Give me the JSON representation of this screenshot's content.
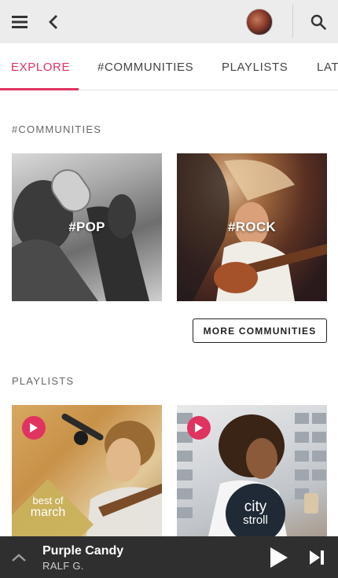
{
  "colors": {
    "accent": "#e0335f",
    "appbar": "#ececec",
    "player": "#2f2f2f"
  },
  "appbar": {
    "menu_icon": "hamburger-menu-icon",
    "back_icon": "chevron-left-icon",
    "avatar_icon": "user-avatar",
    "search_icon": "search-icon"
  },
  "tabs": [
    {
      "label": "EXPLORE",
      "active": true
    },
    {
      "label": "#COMMUNITIES",
      "active": false
    },
    {
      "label": "PLAYLISTS",
      "active": false
    },
    {
      "label": "LAT",
      "active": false
    }
  ],
  "communities": {
    "heading": "#COMMUNITIES",
    "items": [
      {
        "label": "#POP"
      },
      {
        "label": "#ROCK"
      }
    ],
    "more_button": "MORE COMMUNITIES"
  },
  "playlists": {
    "heading": "PLAYLISTS",
    "items": [
      {
        "badge_line1": "best of",
        "badge_line2": "march",
        "play_icon": "play-icon"
      },
      {
        "badge_line1": "city",
        "badge_line2": "stroll",
        "play_icon": "play-icon"
      }
    ]
  },
  "player": {
    "title": "Purple Candy",
    "artist": "RALF G.",
    "expand_icon": "chevron-up-icon",
    "play_icon": "play-icon",
    "next_icon": "skip-next-icon"
  }
}
